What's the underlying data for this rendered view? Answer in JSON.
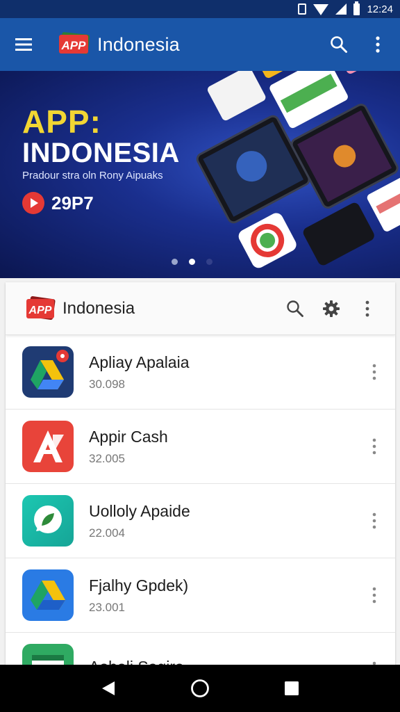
{
  "status_bar": {
    "time": "12:24",
    "icons": [
      "notification-icon",
      "wifi-icon",
      "signal-icon",
      "battery-icon"
    ]
  },
  "app_bar": {
    "logo_text": "APP",
    "title": "Indonesia",
    "icons": [
      "menu-icon",
      "search-icon",
      "more-vert-icon"
    ]
  },
  "banner": {
    "title_line1": "APP:",
    "title_line2": "INDONESIA",
    "subtitle": "Pradour stra oln Rony Aipuaks",
    "play_code": "29P7",
    "carousel_dots": 3,
    "active_dot": 1
  },
  "card": {
    "logo_text": "APP",
    "title": "Indonesia",
    "icons": [
      "search-icon",
      "settings-icon",
      "more-vert-icon"
    ]
  },
  "apps": [
    {
      "name": "Apliay Apalaia",
      "count": "30.098",
      "icon": "drive-triangle-icon"
    },
    {
      "name": "Appir Cash",
      "count": "32.005",
      "icon": "a-letter-icon"
    },
    {
      "name": "Uolloly Apaide",
      "count": "22.004",
      "icon": "chat-bubble-icon"
    },
    {
      "name": "Fjalhy Gpdek)",
      "count": "23.001",
      "icon": "drive-triangle-icon"
    },
    {
      "name": "Aobali Sagira",
      "count": "",
      "icon": "window-icon"
    }
  ],
  "nav_bar": {
    "icons": [
      "back-icon",
      "home-icon",
      "recents-icon"
    ]
  },
  "colors": {
    "app_bar": "#1a56a8",
    "status_bar": "#0f2f6b",
    "banner_yellow": "#f2d633",
    "logo_red": "#e53935"
  }
}
